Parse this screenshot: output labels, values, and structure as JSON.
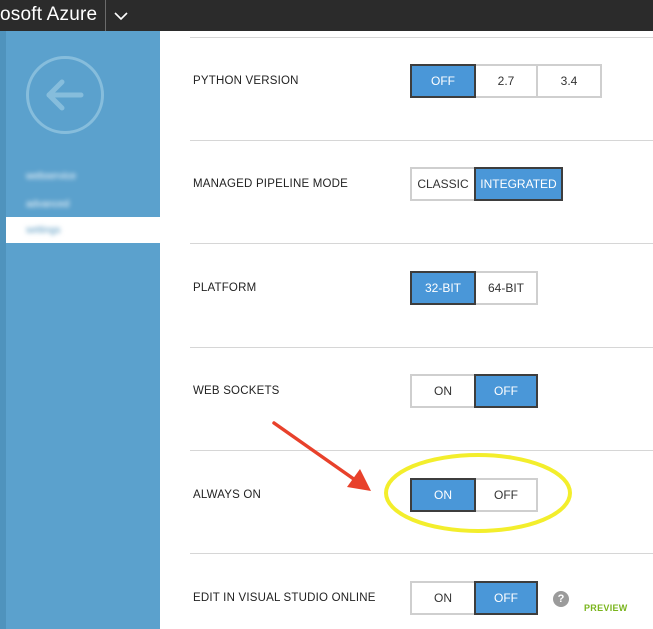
{
  "header": {
    "brand": "osoft Azure",
    "dropdown_icon": "chevron-down-icon"
  },
  "sidebar": {
    "back_icon": "arrow-left-icon",
    "items": [
      {
        "label": "webservice"
      },
      {
        "label": "advanced"
      },
      {
        "label": "settings",
        "selected": true
      }
    ]
  },
  "settings": [
    {
      "label": "PYTHON VERSION",
      "options": [
        "OFF",
        "2.7",
        "3.4"
      ],
      "selected": "OFF"
    },
    {
      "label": "MANAGED PIPELINE MODE",
      "options": [
        "CLASSIC",
        "INTEGRATED"
      ],
      "selected": "INTEGRATED"
    },
    {
      "label": "PLATFORM",
      "options": [
        "32-BIT",
        "64-BIT"
      ],
      "selected": "32-BIT"
    },
    {
      "label": "WEB SOCKETS",
      "options": [
        "ON",
        "OFF"
      ],
      "selected": "OFF"
    },
    {
      "label": "ALWAYS ON",
      "options": [
        "ON",
        "OFF"
      ],
      "selected": "ON"
    },
    {
      "label": "EDIT IN VISUAL STUDIO ONLINE",
      "options": [
        "ON",
        "OFF"
      ],
      "selected": "OFF"
    }
  ],
  "edit_vso": {
    "help_icon": "question-icon",
    "help_glyph": "?",
    "badge": "PREVIEW"
  },
  "annotation": {
    "arrow_color": "#e8412b",
    "highlight_color": "#f3ee2c"
  },
  "colors": {
    "selected": "#4a97d8",
    "sidebar": "#5ba1cd",
    "topbar": "#2b2b2b"
  }
}
